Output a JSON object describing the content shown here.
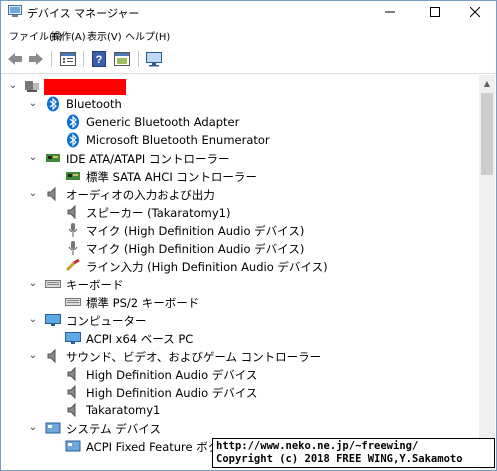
{
  "window": {
    "title": "デバイス マネージャー",
    "controls": {
      "minimize": "—",
      "maximize": "☐",
      "close": "✕"
    }
  },
  "menu": [
    "ファイル(F)",
    "操作(A)",
    "表示(V)",
    "ヘルプ(H)"
  ],
  "toolbar": [
    "back",
    "forward",
    "properties",
    "help",
    "update",
    "monitor"
  ],
  "tree": {
    "root": {
      "label": ""
    },
    "categories": [
      {
        "label": "Bluetooth",
        "icon": "bluetooth-icon",
        "children": [
          "Generic Bluetooth Adapter",
          "Microsoft Bluetooth Enumerator"
        ]
      },
      {
        "label": "IDE ATA/ATAPI コントローラー",
        "icon": "ide-icon",
        "children": [
          "標準 SATA AHCI コントローラー"
        ]
      },
      {
        "label": "オーディオの入力および出力",
        "icon": "audio-io-icon",
        "children": [
          "スピーカー (Takaratomy1)",
          "マイク (High Definition Audio デバイス)",
          "マイク (High Definition Audio デバイス)",
          "ライン入力 (High Definition Audio デバイス)"
        ]
      },
      {
        "label": "キーボード",
        "icon": "keyboard-icon",
        "children": [
          "標準 PS/2 キーボード"
        ]
      },
      {
        "label": "コンピューター",
        "icon": "computer-icon",
        "children": [
          "ACPI x64 ベース PC"
        ]
      },
      {
        "label": "サウンド、ビデオ、およびゲーム コントローラー",
        "icon": "sound-icon",
        "children": [
          "High Definition Audio デバイス",
          "High Definition Audio デバイス",
          "Takaratomy1"
        ]
      },
      {
        "label": "システム デバイス",
        "icon": "system-icon",
        "children": [
          "ACPI Fixed Feature ボタン"
        ]
      }
    ]
  },
  "watermark": {
    "line1": "http://www.neko.ne.jp/~freewing/",
    "line2": "Copyright (c) 2018 FREE WING,Y.Sakamoto"
  },
  "colors": {
    "bluetooth": "#0a6fd6",
    "redaction": "#ff0000",
    "scrollbar_thumb": "#cdcdcd"
  }
}
